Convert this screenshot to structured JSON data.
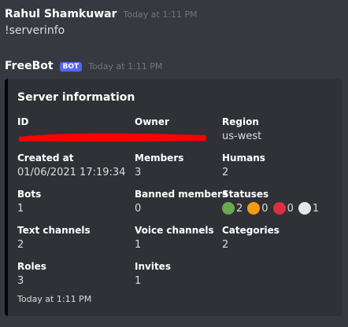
{
  "user_message": {
    "author": "Rahul Shamkuwar",
    "timestamp": "Today at 1:11 PM",
    "content": "!serverinfo"
  },
  "bot_message": {
    "author": "FreeBot",
    "badge": "BOT",
    "timestamp": "Today at 1:11 PM"
  },
  "embed": {
    "accent_color": "#050505",
    "title": "Server information",
    "fields": {
      "id": {
        "name": "ID",
        "value": ""
      },
      "owner": {
        "name": "Owner",
        "value": ""
      },
      "region": {
        "name": "Region",
        "value": "us-west"
      },
      "created_at": {
        "name": "Created at",
        "value": "01/06/2021 17:19:34"
      },
      "members": {
        "name": "Members",
        "value": "3"
      },
      "humans": {
        "name": "Humans",
        "value": "2"
      },
      "bots": {
        "name": "Bots",
        "value": "1"
      },
      "banned": {
        "name": "Banned members",
        "value": "0"
      },
      "statuses": {
        "name": "Statuses",
        "items": [
          {
            "icon": "online-status-icon",
            "color": "#6aa84f",
            "count": "2"
          },
          {
            "icon": "idle-status-icon",
            "color": "#f39c12",
            "count": "0"
          },
          {
            "icon": "dnd-status-icon",
            "color": "#dd2e44",
            "count": "0"
          },
          {
            "icon": "offline-status-icon",
            "color": "#e6e7e8",
            "count": "1"
          }
        ]
      },
      "text_channels": {
        "name": "Text channels",
        "value": "2"
      },
      "voice_channels": {
        "name": "Voice channels",
        "value": "1"
      },
      "categories": {
        "name": "Categories",
        "value": "2"
      },
      "roles": {
        "name": "Roles",
        "value": "3"
      },
      "invites": {
        "name": "Invites",
        "value": "1"
      }
    },
    "footer": "Today at 1:11 PM",
    "redaction_color": "#ff0000"
  }
}
